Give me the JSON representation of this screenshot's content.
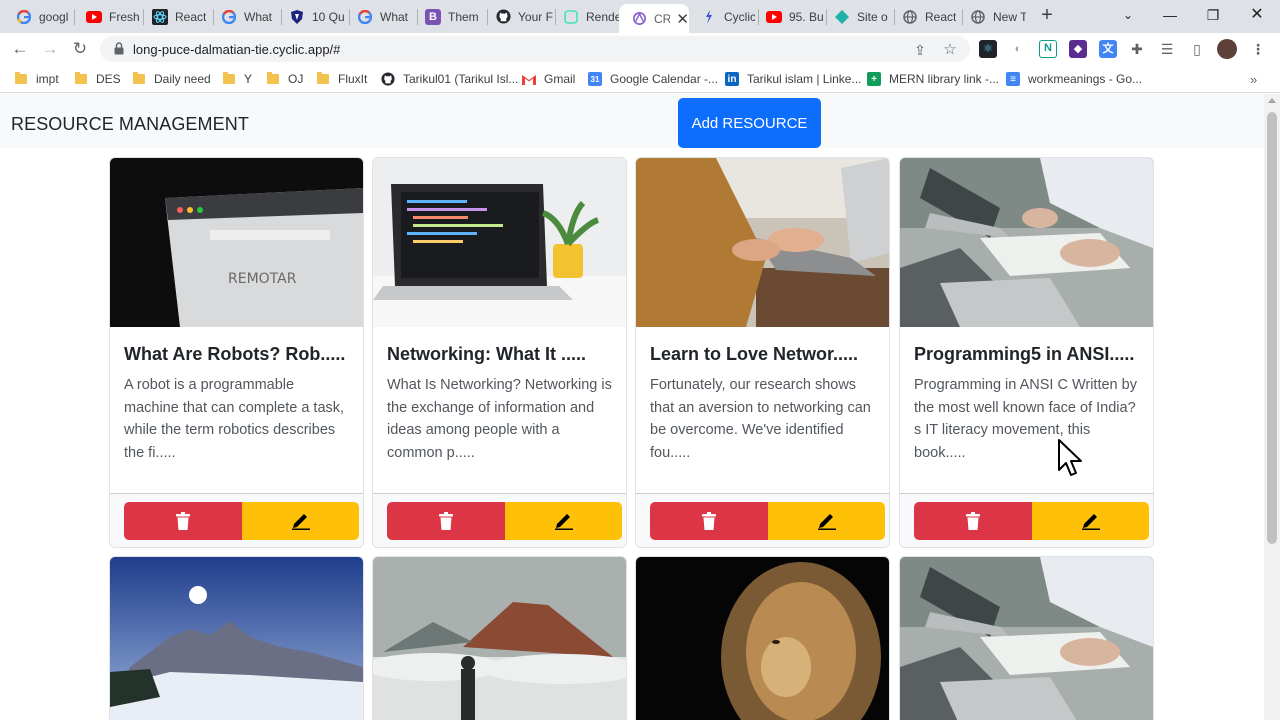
{
  "browser": {
    "tabs": [
      {
        "label": "googl",
        "icon": "google-icon"
      },
      {
        "label": "Freshe",
        "icon": "youtube-icon"
      },
      {
        "label": "React",
        "icon": "react-icon"
      },
      {
        "label": "What",
        "icon": "google-icon"
      },
      {
        "label": "10 Qu",
        "icon": "shield-icon"
      },
      {
        "label": "What",
        "icon": "google-icon"
      },
      {
        "label": "Them",
        "icon": "bootstrap-icon"
      },
      {
        "label": "Your F",
        "icon": "github-icon"
      },
      {
        "label": "Rende",
        "icon": "render-icon"
      },
      {
        "label": "CR",
        "icon": "cyclic-icon",
        "active": true
      },
      {
        "label": "Cyclic",
        "icon": "cyclic-blue-icon"
      },
      {
        "label": "95. Bu",
        "icon": "youtube-icon"
      },
      {
        "label": "Site o",
        "icon": "netlify-icon"
      },
      {
        "label": "React",
        "icon": "globe-icon"
      },
      {
        "label": "New T",
        "icon": "globe-icon"
      }
    ],
    "url": "long-puce-dalmatian-tie.cyclic.app/#",
    "bookmarks": [
      {
        "label": "impt",
        "icon": "folder-icon"
      },
      {
        "label": "DES",
        "icon": "folder-icon"
      },
      {
        "label": "Daily need",
        "icon": "folder-icon"
      },
      {
        "label": "Y",
        "icon": "folder-icon"
      },
      {
        "label": "OJ",
        "icon": "folder-icon"
      },
      {
        "label": "FluxIt",
        "icon": "folder-icon"
      },
      {
        "label": "Tarikul01 (Tarikul Isl...",
        "icon": "github-icon"
      },
      {
        "label": "Gmail",
        "icon": "gmail-icon"
      },
      {
        "label": "Google Calendar -...",
        "icon": "calendar-icon"
      },
      {
        "label": "Tarikul islam | Linke...",
        "icon": "linkedin-icon"
      },
      {
        "label": "MERN library link -...",
        "icon": "sheets-icon"
      },
      {
        "label": "workmeanings - Go...",
        "icon": "docs-icon"
      }
    ],
    "colors": {
      "tabstrip": "#dee1e6",
      "omnibox": "#f1f3f4"
    }
  },
  "app": {
    "brand": "RESOURCE MANAGEMENT",
    "add_button": "Add RESOURCE",
    "colors": {
      "primary": "#0d6efd",
      "danger": "#dc3545",
      "warning": "#ffc107"
    },
    "cards": [
      {
        "title": "What Are Robots? Rob.....",
        "description": "A robot is a programmable machine that can complete a task, while the term robotics describes the fi.....",
        "image": "browser-screen-photo"
      },
      {
        "title": "Networking: What It .....",
        "description": "What Is Networking? Networking is the exchange of information and ideas among people with a common p.....",
        "image": "laptop-code-photo"
      },
      {
        "title": "Learn to Love Networ.....",
        "description": "Fortunately, our research shows that an aversion to networking can be overcome. We've identified fou.....",
        "image": "typing-laptop-photo"
      },
      {
        "title": "Programming5 in ANSI.....",
        "description": "Programming in ANSI C Written by the most well known face of India?s IT literacy movement, this book.....",
        "image": "meeting-laptops-photo"
      },
      {
        "image": "snowy-mountains-photo"
      },
      {
        "image": "volcano-clouds-photo"
      },
      {
        "image": "lion-photo"
      },
      {
        "image": "meeting-laptops-photo"
      }
    ]
  }
}
